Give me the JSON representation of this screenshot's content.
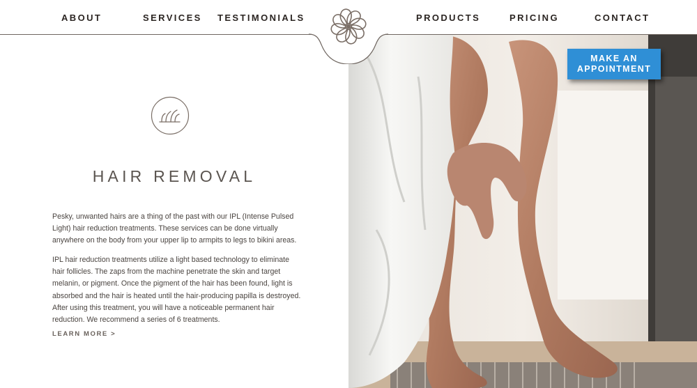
{
  "nav": {
    "about": "ABOUT",
    "services": "SERVICES",
    "testimonials": "TESTIMONIALS",
    "products": "PRODUCTS",
    "pricing": "PRICING",
    "contact": "CONTACT"
  },
  "cta": {
    "line1": "MAKE AN",
    "line2": "APPOINTMENT"
  },
  "service": {
    "icon": "hair-follicle-icon",
    "title": "HAIR REMOVAL",
    "paragraph1": "Pesky, unwanted hairs are a thing of the past with our IPL (Intense Pulsed Light) hair reduction treatments. These services can be done virtually anywhere on the body from your upper lip to armpits to legs to bikini areas.",
    "paragraph2": "IPL hair reduction treatments utilize a light based technology to eliminate hair follicles. The zaps from the machine penetrate the skin and target melanin, or pigment. Once the pigment of the hair has been found, light is absorbed and the hair is heated until the hair-producing papilla is destroyed. After using this treatment, you will have a noticeable permanent hair reduction. We recommend a series of 6 treatments.",
    "learn_more": "LEARN MORE >"
  },
  "colors": {
    "accent": "#2f8fd6",
    "text": "#5b5550",
    "rule": "#6f6660"
  }
}
